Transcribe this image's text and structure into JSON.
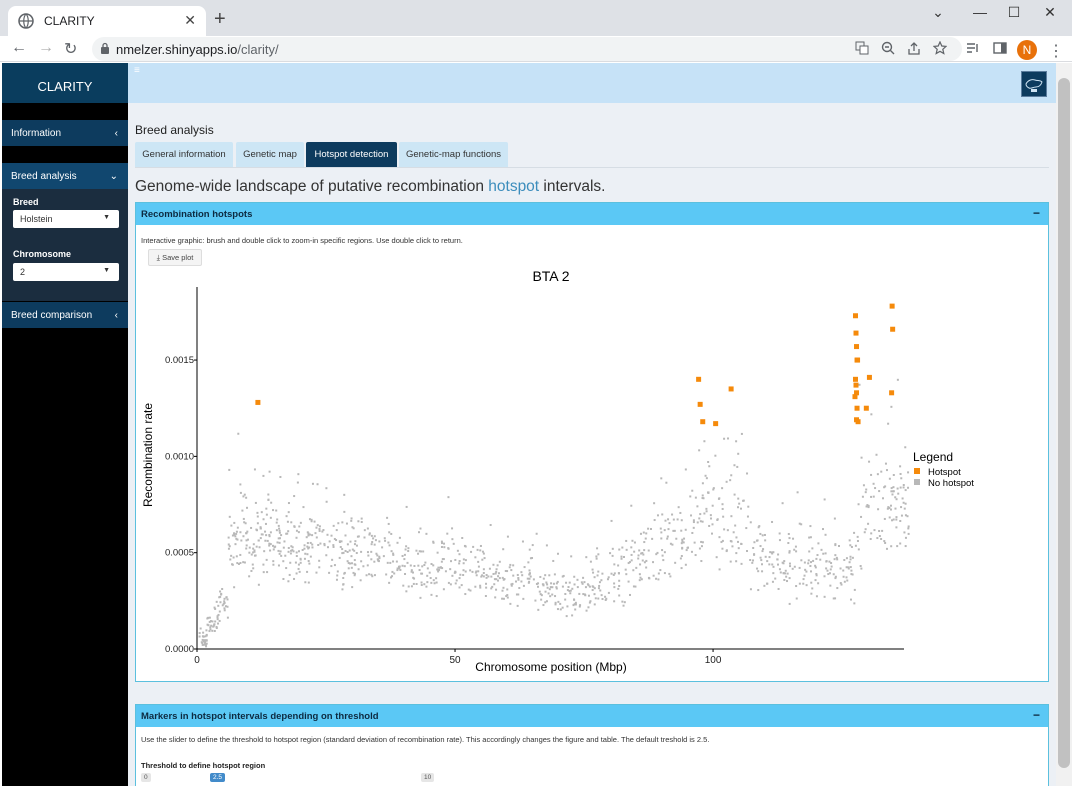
{
  "browser": {
    "tab_title": "CLARITY",
    "url_host": "nmelzer.shinyapps.io",
    "url_path": "/clarity/",
    "profile_initial": "N"
  },
  "app": {
    "brand": "CLARITY",
    "sidebar": {
      "information": "Information",
      "breed_analysis": "Breed analysis",
      "breed_label": "Breed",
      "breed_value": "Holstein",
      "chromosome_label": "Chromosome",
      "chromosome_value": "2",
      "breed_comparison": "Breed comparison"
    },
    "page_title": "Breed analysis",
    "tabs": [
      "General information",
      "Genetic map",
      "Hotspot detection",
      "Genetic-map functions"
    ],
    "active_tab": "Hotspot detection",
    "heading_prefix": "Genome-wide landscape of putative recombination ",
    "heading_highlight": "hotspot",
    "heading_suffix": " intervals.",
    "hotspot_box": {
      "title": "Recombination hotspots",
      "description": "Interactive graphic: brush and double click to zoom-in specific regions. Use double click to return.",
      "save_label": "Save plot"
    },
    "markers_box": {
      "title": "Markers in hotspot intervals depending on threshold",
      "description": "Use the slider to define the threshold to hotspot region (standard deviation of recombination rate). This accordingly changes the figure and table. The default treshold is 2.5.",
      "slider_label": "Threshold to define hotspot region",
      "slider_min": "0",
      "slider_value": "2.5",
      "slider_max": "10"
    }
  },
  "chart_data": {
    "type": "scatter",
    "title": "BTA 2",
    "xlabel": "Chromosome position (Mbp)",
    "ylabel": "Recombination rate",
    "xlim": [
      0,
      137
    ],
    "ylim": [
      0,
      0.0019
    ],
    "x_ticks": [
      "0",
      "50",
      "100"
    ],
    "y_ticks": [
      "0.0000",
      "0.0005",
      "0.0010",
      "0.0015"
    ],
    "legend": {
      "title": "Legend",
      "position": "right"
    },
    "series": [
      {
        "name": "Hotspot",
        "color": "#f58a0b",
        "points": [
          [
            11.8,
            0.00128
          ],
          [
            97.2,
            0.0014
          ],
          [
            97.5,
            0.00127
          ],
          [
            98.0,
            0.00118
          ],
          [
            100.5,
            0.00117
          ],
          [
            103.5,
            0.00135
          ],
          [
            127.6,
            0.00173
          ],
          [
            127.7,
            0.00164
          ],
          [
            127.8,
            0.00157
          ],
          [
            127.9,
            0.0015
          ],
          [
            128.0,
            0.0015
          ],
          [
            127.6,
            0.0014
          ],
          [
            127.7,
            0.00137
          ],
          [
            127.8,
            0.00133
          ],
          [
            127.5,
            0.00131
          ],
          [
            127.9,
            0.00125
          ],
          [
            127.8,
            0.00119
          ],
          [
            128.1,
            0.00118
          ],
          [
            129.7,
            0.00125
          ],
          [
            130.3,
            0.00141
          ],
          [
            134.7,
            0.00178
          ],
          [
            134.8,
            0.00166
          ],
          [
            134.6,
            0.00133
          ]
        ]
      },
      {
        "name": "No hotspot",
        "color": "#b8b8b8",
        "segments": [
          [
            0.5,
            5e-05,
            5e-05
          ],
          [
            2,
            0.00012,
            5e-05
          ],
          [
            4,
            0.00022,
            8e-05
          ],
          [
            6,
            0.0005,
            0.00015
          ],
          [
            8,
            0.0006,
            0.0002
          ],
          [
            10,
            0.00055,
            0.00018
          ],
          [
            12,
            0.00062,
            0.00018
          ],
          [
            14,
            0.00058,
            0.00015
          ],
          [
            16,
            0.00055,
            0.00015
          ],
          [
            18,
            0.00052,
            0.00014
          ],
          [
            20,
            0.0005,
            0.00015
          ],
          [
            22,
            0.00055,
            0.00016
          ],
          [
            25,
            0.00052,
            0.00015
          ],
          [
            28,
            0.0005,
            0.00016
          ],
          [
            30,
            0.00048,
            0.00016
          ],
          [
            32,
            0.0005,
            0.00015
          ],
          [
            35,
            0.00046,
            0.00014
          ],
          [
            38,
            0.00045,
            0.00013
          ],
          [
            41,
            0.0004,
            0.00012
          ],
          [
            44,
            0.00042,
            0.00012
          ],
          [
            47,
            0.00046,
            0.00014
          ],
          [
            50,
            0.00042,
            0.00012
          ],
          [
            53,
            0.0004,
            0.00012
          ],
          [
            56,
            0.00038,
            0.00011
          ],
          [
            59,
            0.00036,
            0.00011
          ],
          [
            62,
            0.00034,
            0.0001
          ],
          [
            65,
            0.00032,
            0.0001
          ],
          [
            68,
            0.0003,
            9e-05
          ],
          [
            71,
            0.00028,
            9e-05
          ],
          [
            74,
            0.0003,
            0.0001
          ],
          [
            77,
            0.00032,
            0.0001
          ],
          [
            80,
            0.00038,
            0.00012
          ],
          [
            83,
            0.00043,
            0.00013
          ],
          [
            86,
            0.00048,
            0.00015
          ],
          [
            89,
            0.00052,
            0.00016
          ],
          [
            92,
            0.0006,
            0.00017
          ],
          [
            95,
            0.00065,
            0.00018
          ],
          [
            98,
            0.00075,
            0.00025
          ],
          [
            101,
            0.00065,
            0.0002
          ],
          [
            104,
            0.0007,
            0.00025
          ],
          [
            107,
            0.00048,
            0.00015
          ],
          [
            110,
            0.00045,
            0.00015
          ],
          [
            113,
            0.00042,
            0.00015
          ],
          [
            116,
            0.00045,
            0.00015
          ],
          [
            119,
            0.00042,
            0.00015
          ],
          [
            122,
            0.0004,
            0.00015
          ],
          [
            125,
            0.00045,
            0.00018
          ],
          [
            128,
            0.0007,
            0.00025
          ],
          [
            131,
            0.00075,
            0.00025
          ],
          [
            134,
            0.00078,
            0.00025
          ],
          [
            136,
            0.0007,
            0.0002
          ]
        ]
      }
    ]
  }
}
